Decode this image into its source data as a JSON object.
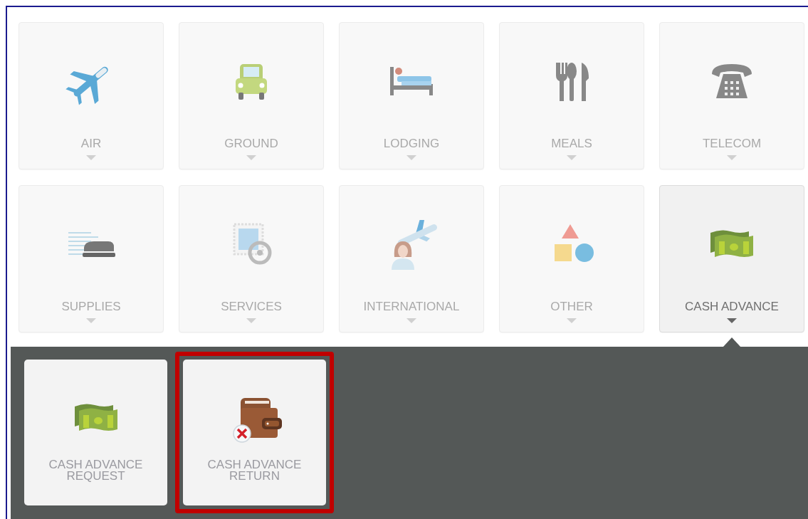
{
  "categories": [
    {
      "label": "AIR",
      "kind": "air",
      "selected": false
    },
    {
      "label": "GROUND",
      "kind": "ground",
      "selected": false
    },
    {
      "label": "LODGING",
      "kind": "lodging",
      "selected": false
    },
    {
      "label": "MEALS",
      "kind": "meals",
      "selected": false
    },
    {
      "label": "TELECOM",
      "kind": "telecom",
      "selected": false
    },
    {
      "label": "SUPPLIES",
      "kind": "supplies",
      "selected": false
    },
    {
      "label": "SERVICES",
      "kind": "services",
      "selected": false
    },
    {
      "label": "INTERNATIONAL",
      "kind": "international",
      "selected": false
    },
    {
      "label": "OTHER",
      "kind": "other",
      "selected": false
    },
    {
      "label": "CASH ADVANCE",
      "kind": "cash",
      "selected": true
    }
  ],
  "subitems": [
    {
      "label": "CASH ADVANCE REQUEST",
      "kind": "cash",
      "highlighted": false
    },
    {
      "label": "CASH ADVANCE RETURN",
      "kind": "wallet",
      "highlighted": true
    }
  ]
}
